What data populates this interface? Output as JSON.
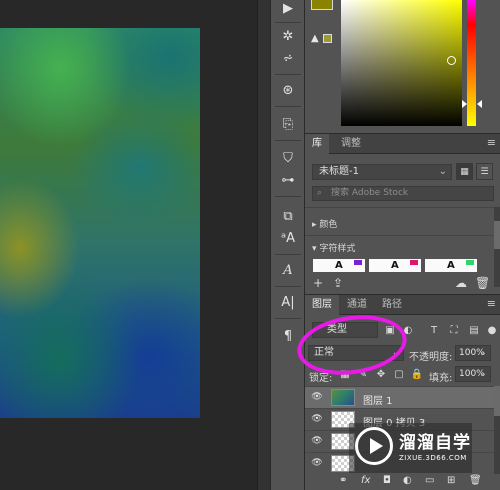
{
  "tool_strip": {
    "icons": [
      "play-icon",
      "brush-settings-icon",
      "brush-presets-icon",
      "clone-source-icon",
      "history-icon",
      "paint-bucket-icon",
      "adjust-icon",
      "actions-icon",
      "character-styles-icon",
      "paragraph-styles-icon",
      "character-panel-icon",
      "paragraph-panel-icon",
      "glyphs-icon"
    ]
  },
  "color_panel": {
    "foreground_color": "#8a8300",
    "warning_swatch_color": "#9c9a35"
  },
  "library_panel": {
    "tabs": [
      {
        "label": "库",
        "active": true
      },
      {
        "label": "调整",
        "active": false
      }
    ],
    "library_name": "未标题-1",
    "search_placeholder": "搜索 Adobe Stock",
    "sections": {
      "colors": "颜色",
      "char_styles": "字符样式"
    },
    "char_style_glyph": "A",
    "char_style_colors": [
      "#7a1fd6",
      "#e0156e",
      "#2fd46b"
    ]
  },
  "layers_panel": {
    "tabs": [
      {
        "label": "图层",
        "active": true
      },
      {
        "label": "通道",
        "active": false
      },
      {
        "label": "路径",
        "active": false
      }
    ],
    "filter_kind": "类型",
    "blend_mode": "正常",
    "opacity_label": "不透明度:",
    "opacity_value": "100%",
    "lock_label": "锁定:",
    "fill_label": "填充:",
    "fill_value": "100%",
    "layers": [
      {
        "name": "图层 1",
        "selected": true
      },
      {
        "name": "图层 0 拷贝 3",
        "selected": false
      },
      {
        "name": "",
        "selected": false
      },
      {
        "name": "",
        "selected": false
      }
    ],
    "footer_fx": "fx"
  },
  "annotation_color": "#e81ae8",
  "watermark": {
    "title": "溜溜自学",
    "url": "ZIXUE.3D66.COM"
  }
}
